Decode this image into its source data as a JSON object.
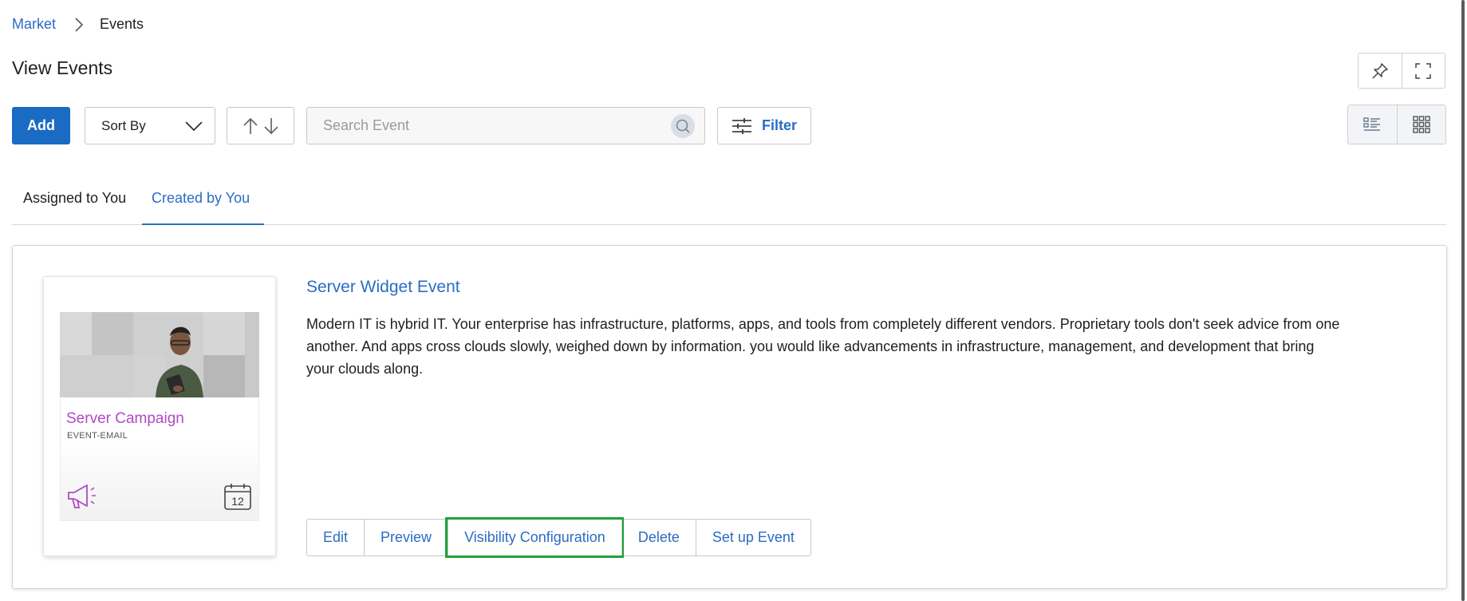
{
  "breadcrumb": {
    "parent": "Market",
    "current": "Events"
  },
  "page_title": "View Events",
  "toolbar": {
    "add_label": "Add",
    "sort_label": "Sort By",
    "search_placeholder": "Search Event",
    "filter_label": "Filter"
  },
  "tabs": [
    {
      "label": "Assigned to You",
      "active": false
    },
    {
      "label": "Created by You",
      "active": true
    }
  ],
  "event": {
    "title": "Server Widget Event",
    "description": "Modern IT is hybrid IT. Your enterprise has infrastructure, platforms, apps, and tools from completely different vendors. Proprietary tools don't seek advice from one another. And apps cross clouds slowly, weighed down by information. you would like advancements in infrastructure, management, and development that bring your clouds along.",
    "thumbnail": {
      "title": "Server Campaign",
      "subtitle": "EVENT-EMAIL",
      "calendar_day": "12"
    },
    "actions": [
      "Edit",
      "Preview",
      "Visibility Configuration",
      "Delete",
      "Set up Event"
    ],
    "focused_action": "Visibility Configuration"
  },
  "colors": {
    "accent": "#2b6cc4",
    "primary_button": "#1a6bc4",
    "campaign_purple": "#b049c6",
    "focus_outline": "#1fa23a"
  },
  "icons": [
    "chevron-right-icon",
    "pin-icon",
    "fullscreen-icon",
    "chevron-down-icon",
    "sort-up-icon",
    "sort-down-icon",
    "search-icon",
    "filter-sliders-icon",
    "list-view-icon",
    "grid-view-icon",
    "megaphone-icon",
    "calendar-icon"
  ]
}
